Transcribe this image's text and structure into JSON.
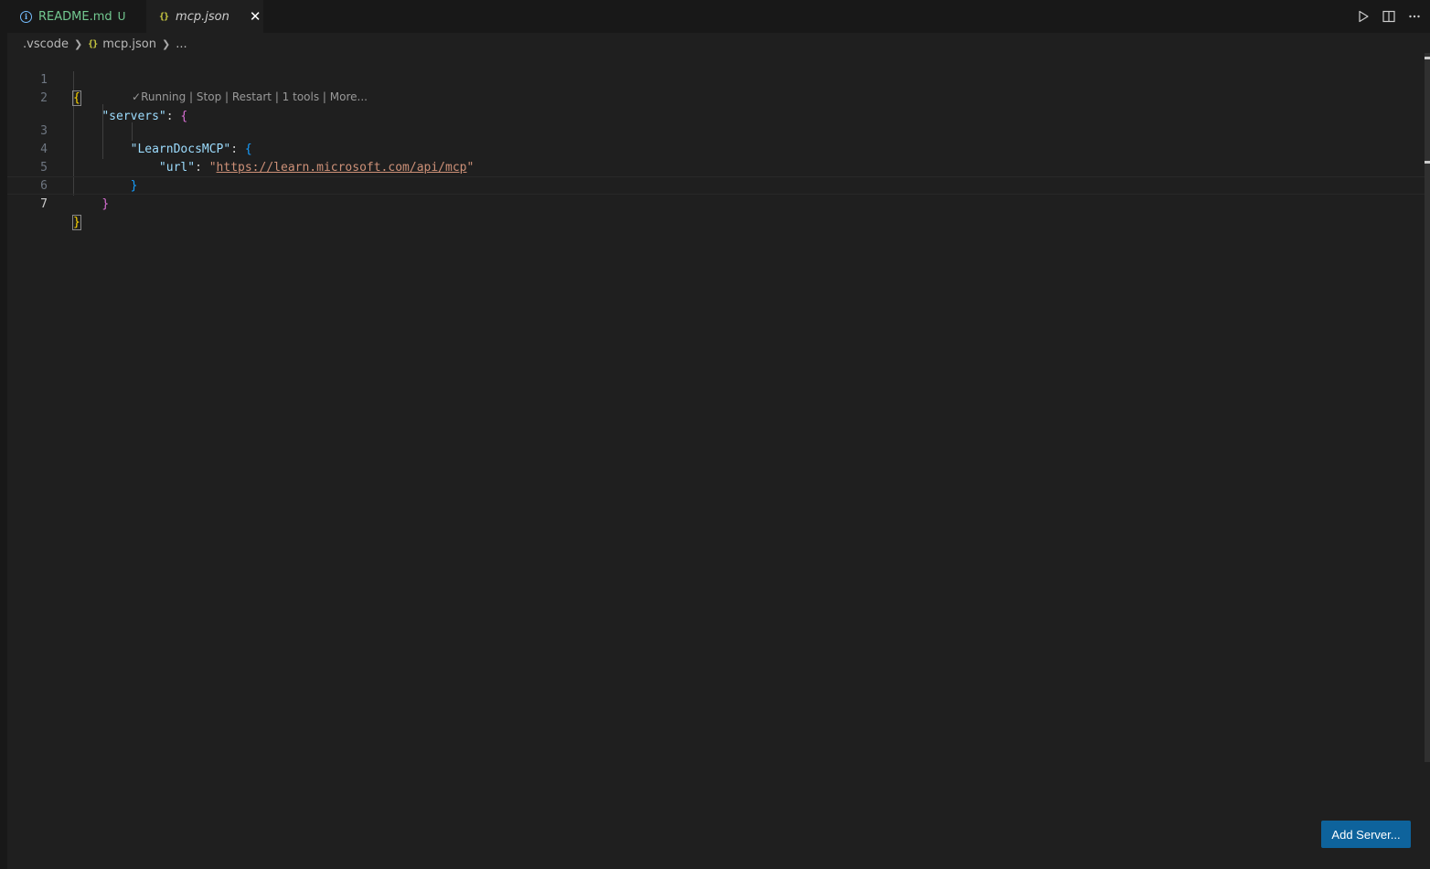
{
  "tabs": [
    {
      "label": "README.md",
      "badge": "U"
    },
    {
      "label": "mcp.json"
    }
  ],
  "breadcrumb": {
    "folder": ".vscode",
    "file": "mcp.json",
    "more": "..."
  },
  "editor": {
    "lines": [
      {
        "n": "1"
      },
      {
        "n": "2",
        "key": "\"servers\"",
        "colon": ": "
      },
      {
        "n": "3",
        "key": "\"LearnDocsMCP\"",
        "colon": ": "
      },
      {
        "n": "4",
        "key": "\"url\"",
        "colon": ": ",
        "quote_open": "\"",
        "value": "https://learn.microsoft.com/api/mcp",
        "quote_close": "\""
      },
      {
        "n": "5"
      },
      {
        "n": "6"
      },
      {
        "n": "7"
      }
    ],
    "brackets": {
      "open": "{",
      "close": "}"
    },
    "codelens": {
      "check": "✓",
      "running": "Running",
      "sep": " | ",
      "stop": "Stop",
      "restart": "Restart",
      "tools": "1 tools",
      "more": "More..."
    }
  },
  "add_server_label": "Add Server...",
  "icons": {
    "readme_tab": "info-icon",
    "json_tab": "braces-icon",
    "close": "close-icon",
    "run": "play-icon",
    "split": "split-editor-icon",
    "more": "ellipsis-icon"
  },
  "colors": {
    "accent_button": "#0e639c",
    "untracked_green": "#73c991",
    "json_icon_yellow": "#cbcb41"
  }
}
